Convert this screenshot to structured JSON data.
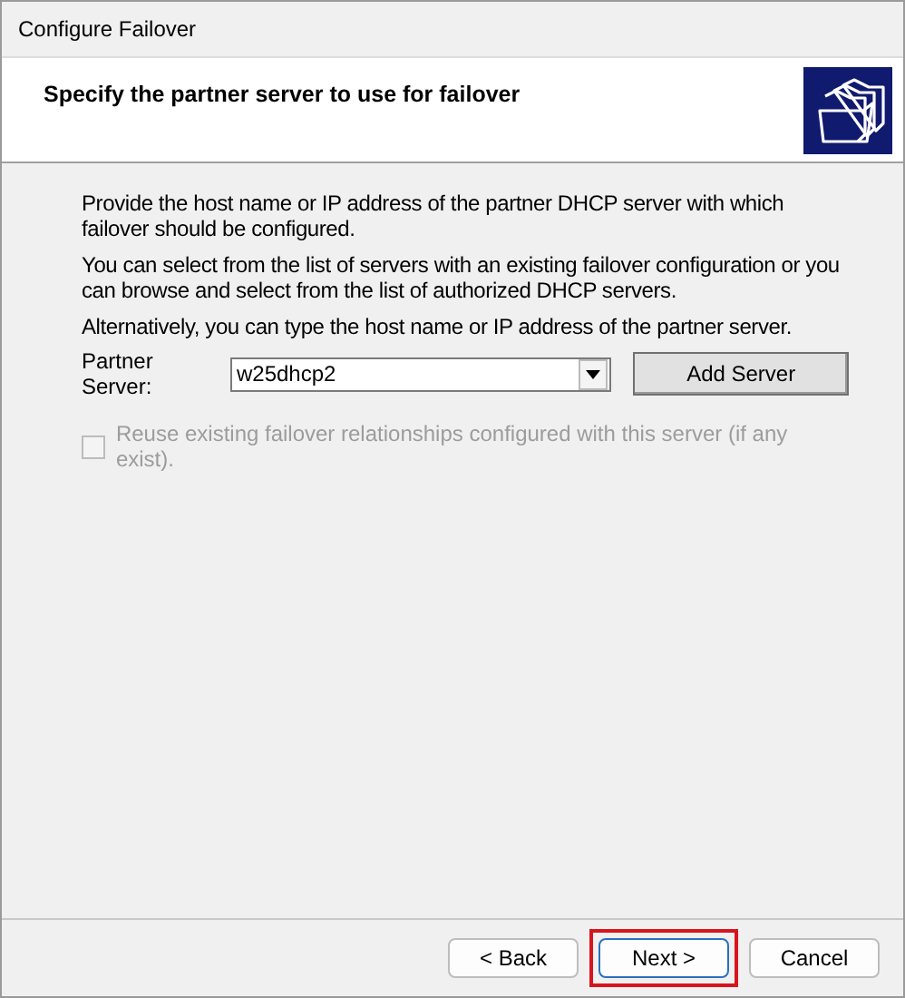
{
  "window": {
    "title": "Configure Failover"
  },
  "header": {
    "title": "Specify the partner server to use for failover"
  },
  "paragraphs": [
    "Provide the host name or IP address of the partner DHCP server with which failover should be configured.",
    "You can select from the list of servers with an existing failover configuration or you can browse and select from the list of authorized DHCP servers.",
    "Alternatively, you can type the host name or IP address of the partner server."
  ],
  "partner_server": {
    "label": "Partner Server:",
    "value": "w25dhcp2",
    "button": "Add Server"
  },
  "reuse_checkbox": {
    "label": "Reuse existing failover relationships configured with this server (if any exist).",
    "checked": false,
    "disabled": true
  },
  "buttons": [
    {
      "label": "< Back",
      "default": false,
      "highlighted": false
    },
    {
      "label": "Next >",
      "default": true,
      "highlighted": true
    },
    {
      "label": "Cancel",
      "default": false,
      "highlighted": false
    }
  ]
}
